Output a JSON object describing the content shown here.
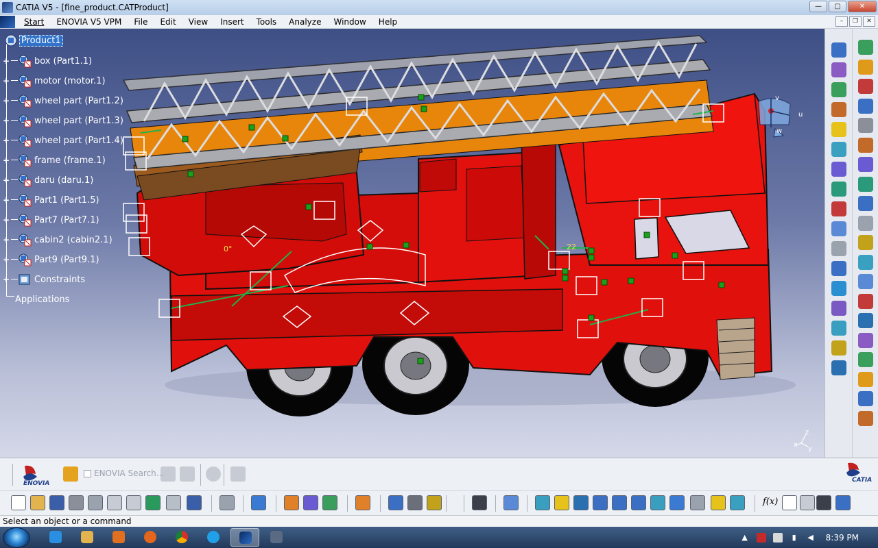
{
  "window": {
    "title": "CATIA V5 - [fine_product.CATProduct]",
    "buttons": {
      "minimize": "—",
      "maximize": "▢",
      "close": "✕"
    }
  },
  "menubar": {
    "items": [
      {
        "label": "Start"
      },
      {
        "label": "ENOVIA V5 VPM"
      },
      {
        "label": "File"
      },
      {
        "label": "Edit"
      },
      {
        "label": "View"
      },
      {
        "label": "Insert"
      },
      {
        "label": "Tools"
      },
      {
        "label": "Analyze"
      },
      {
        "label": "Window"
      },
      {
        "label": "Help"
      }
    ],
    "mdi_buttons": {
      "minimize": "–",
      "restore": "❐",
      "close": "✕"
    }
  },
  "tree": {
    "root": "Product1",
    "items": [
      {
        "label": "box (Part1.1)"
      },
      {
        "label": "motor (motor.1)"
      },
      {
        "label": "wheel part (Part1.2)"
      },
      {
        "label": "wheel part (Part1.3)"
      },
      {
        "label": "wheel part (Part1.4)"
      },
      {
        "label": "frame (frame.1)"
      },
      {
        "label": "daru (daru.1)"
      },
      {
        "label": "Part1 (Part1.5)"
      },
      {
        "label": "Part7 (Part7.1)"
      },
      {
        "label": "cabin2 (cabin2.1)"
      },
      {
        "label": "Part9 (Part9.1)"
      },
      {
        "label": "Constraints"
      }
    ],
    "applications": "Applications"
  },
  "viewport": {
    "annotations": {
      "angle": "0°",
      "distance": "22"
    },
    "compass": {
      "v": "v",
      "u": "u",
      "w": "w"
    },
    "axis": {
      "z": "z",
      "x": "x",
      "y": "y"
    }
  },
  "bottom_toolbar": {
    "enovia_search": "ENOVIA Search...",
    "enovia_logo_text": "ENOVIA",
    "catia_logo_text": "CATIA",
    "formula_label": "f(x)"
  },
  "status": {
    "message": "Select an object or a command"
  },
  "taskbar": {
    "clock": "8:39 PM"
  },
  "colors": {
    "viewport_top": "#3e4f86",
    "viewport_bottom": "#d5d8e8",
    "truck_red": "#e0100c",
    "ladder_gray": "#a9abb0",
    "selection_blue": "#3173c9",
    "constraint_green": "#22b14c"
  }
}
